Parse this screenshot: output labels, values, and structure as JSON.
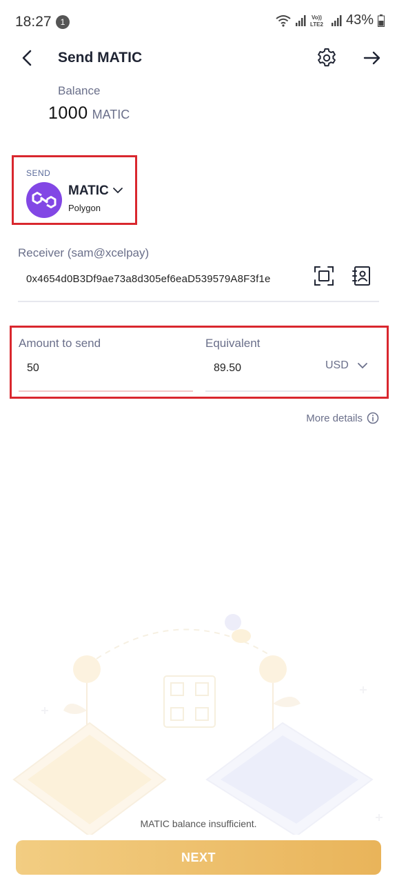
{
  "status_bar": {
    "time": "18:27",
    "notification_count": "1",
    "network_label": "Vo)) LTE2",
    "battery": "43%"
  },
  "header": {
    "title": "Send MATIC",
    "icons": {
      "back": "back-arrow-icon",
      "settings": "gear-icon",
      "forward": "forward-arrow-icon"
    }
  },
  "balance": {
    "label": "Balance",
    "value": "1000",
    "unit": "MATIC"
  },
  "send": {
    "label": "SEND",
    "token_name": "MATIC",
    "network": "Polygon",
    "token_color": "#8247e5"
  },
  "receiver": {
    "label": "Receiver (sam@xcelpay)",
    "address": "0x4654d0B3Df9ae73a8d305ef6eaD539579A8F3f1e"
  },
  "amount": {
    "label": "Amount to send",
    "value": "50"
  },
  "equivalent": {
    "label": "Equivalent",
    "value": "89.50",
    "currency": "USD"
  },
  "more_details": "More details",
  "warning": "MATIC balance insufficient.",
  "next_button": "NEXT",
  "colors": {
    "highlight_border": "#d9272e",
    "accent_button": "#e9b45a",
    "label_gray": "#6a6f8a"
  }
}
